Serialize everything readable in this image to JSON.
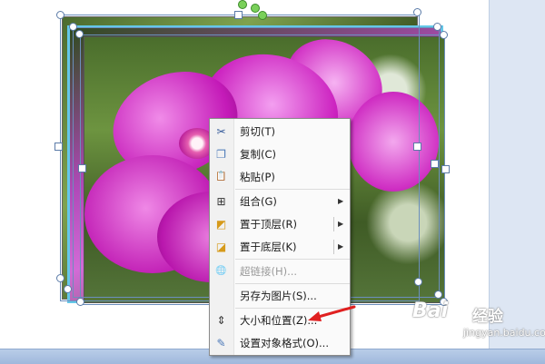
{
  "context_menu": {
    "items": [
      {
        "label": "剪切(T)",
        "icon": "scissors-icon",
        "icon_glyph": "✂",
        "disabled": false,
        "submenu": false
      },
      {
        "label": "复制(C)",
        "icon": "copy-icon",
        "icon_glyph": "❐",
        "disabled": false,
        "submenu": false
      },
      {
        "label": "粘贴(P)",
        "icon": "paste-icon",
        "icon_glyph": "📋",
        "disabled": false,
        "submenu": false
      },
      {
        "label": "组合(G)",
        "icon": "group-icon",
        "icon_glyph": "⊞",
        "disabled": false,
        "submenu": true
      },
      {
        "label": "置于顶层(R)",
        "icon": "bring-to-front-icon",
        "icon_glyph": "◩",
        "disabled": false,
        "submenu": true
      },
      {
        "label": "置于底层(K)",
        "icon": "send-to-back-icon",
        "icon_glyph": "◪",
        "disabled": false,
        "submenu": true
      },
      {
        "label": "超链接(H)...",
        "icon": "hyperlink-icon",
        "icon_glyph": "🌐",
        "disabled": true,
        "submenu": false
      },
      {
        "label": "另存为图片(S)...",
        "icon": "",
        "icon_glyph": "",
        "disabled": false,
        "submenu": false
      },
      {
        "label": "大小和位置(Z)...",
        "icon": "size-position-icon",
        "icon_glyph": "⇕",
        "disabled": false,
        "submenu": false
      },
      {
        "label": "设置对象格式(O)...",
        "icon": "format-object-icon",
        "icon_glyph": "✎",
        "disabled": false,
        "submenu": false
      }
    ],
    "submenu_arrow_glyph": "▶"
  },
  "watermark": {
    "brand": "Bai",
    "brand_cn": "经验",
    "url": "jingyan.baidu.com"
  },
  "colors": {
    "annotation_arrow": "#e02020",
    "selection_border": "#6b8fbd",
    "rotation_handle": "#7ad05a",
    "picture_frame": "#64c8e8"
  }
}
